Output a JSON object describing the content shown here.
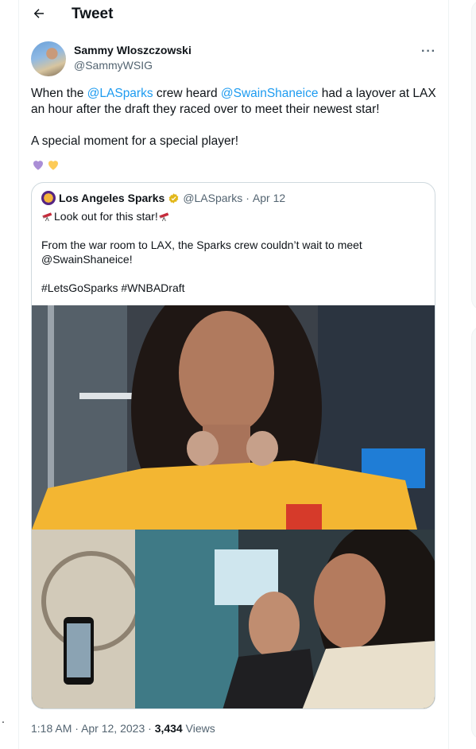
{
  "header": {
    "title": "Tweet",
    "back_icon": "arrow-left-icon"
  },
  "author": {
    "name": "Sammy Wloszczowski",
    "handle": "@SammyWSIG",
    "more_icon": "more-horizontal-icon"
  },
  "tweet": {
    "line1_pre": "When the ",
    "mention1": "@LASparks",
    "line1_mid": " crew heard ",
    "mention2": "@SwainShaneice",
    "line1_post": " had a layover at LAX an hour after the draft they raced over to meet their newest star!",
    "line2": "A special moment for a special player!",
    "emoji": [
      "purple-heart-icon",
      "yellow-heart-icon"
    ]
  },
  "quote": {
    "name": "Los Angeles Sparks",
    "handle": "@LASparks",
    "separator": "·",
    "date": "Apr 12",
    "line1": "Look out for this star!",
    "line2": "From the war room to LAX, the Sparks crew couldn’t wait to meet @SwainShaneice!",
    "line3": "#LetsGoSparks #WNBADraft"
  },
  "footer": {
    "time": "1:18 AM",
    "dot": "·",
    "date": "Apr 12, 2023",
    "views_count": "3,434",
    "views_label": "Views"
  },
  "left_rail": {
    "marker": "."
  },
  "colors": {
    "link": "#1d9bf0",
    "text": "#0f1419",
    "secondary": "#536471",
    "border": "#cfd9de"
  }
}
